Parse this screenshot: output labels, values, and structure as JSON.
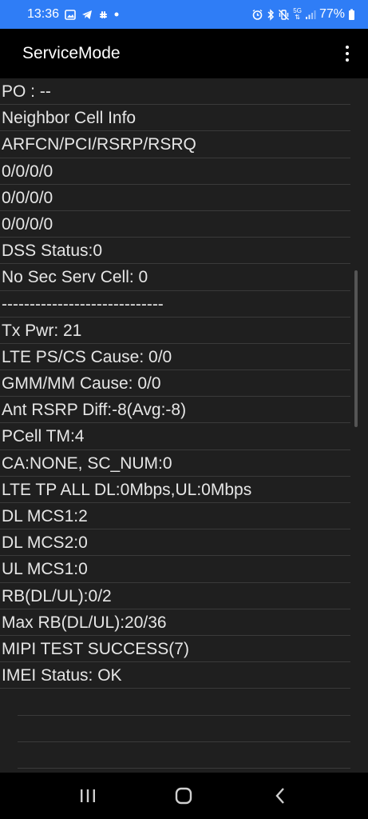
{
  "status_bar": {
    "time": "13:36",
    "battery_percent": "77%",
    "network_badge": "5G"
  },
  "app_bar": {
    "title": "ServiceMode"
  },
  "rows": [
    "PO : --",
    "Neighbor Cell Info",
    "ARFCN/PCI/RSRP/RSRQ",
    "0/0/0/0",
    "0/0/0/0",
    "0/0/0/0",
    "DSS Status:0",
    "No Sec Serv Cell: 0",
    "-----------------------------",
    "Tx Pwr: 21",
    "LTE PS/CS Cause: 0/0",
    "GMM/MM Cause: 0/0",
    "Ant RSRP Diff:-8(Avg:-8)",
    "PCell TM:4",
    "CA:NONE, SC_NUM:0",
    "LTE TP ALL DL:0Mbps,UL:0Mbps",
    "DL MCS1:2",
    "DL MCS2:0",
    "UL MCS1:0",
    "RB(DL/UL):0/2",
    "Max RB(DL/UL):20/36",
    "MIPI TEST SUCCESS(7)",
    "IMEI Status: OK",
    "",
    "",
    ""
  ],
  "colors": {
    "status_bar": "#2f7df6",
    "app_bar": "#000000",
    "content_bg": "#1f1f1f",
    "text": "#e6e6e6",
    "divider": "#3a3a3a"
  }
}
